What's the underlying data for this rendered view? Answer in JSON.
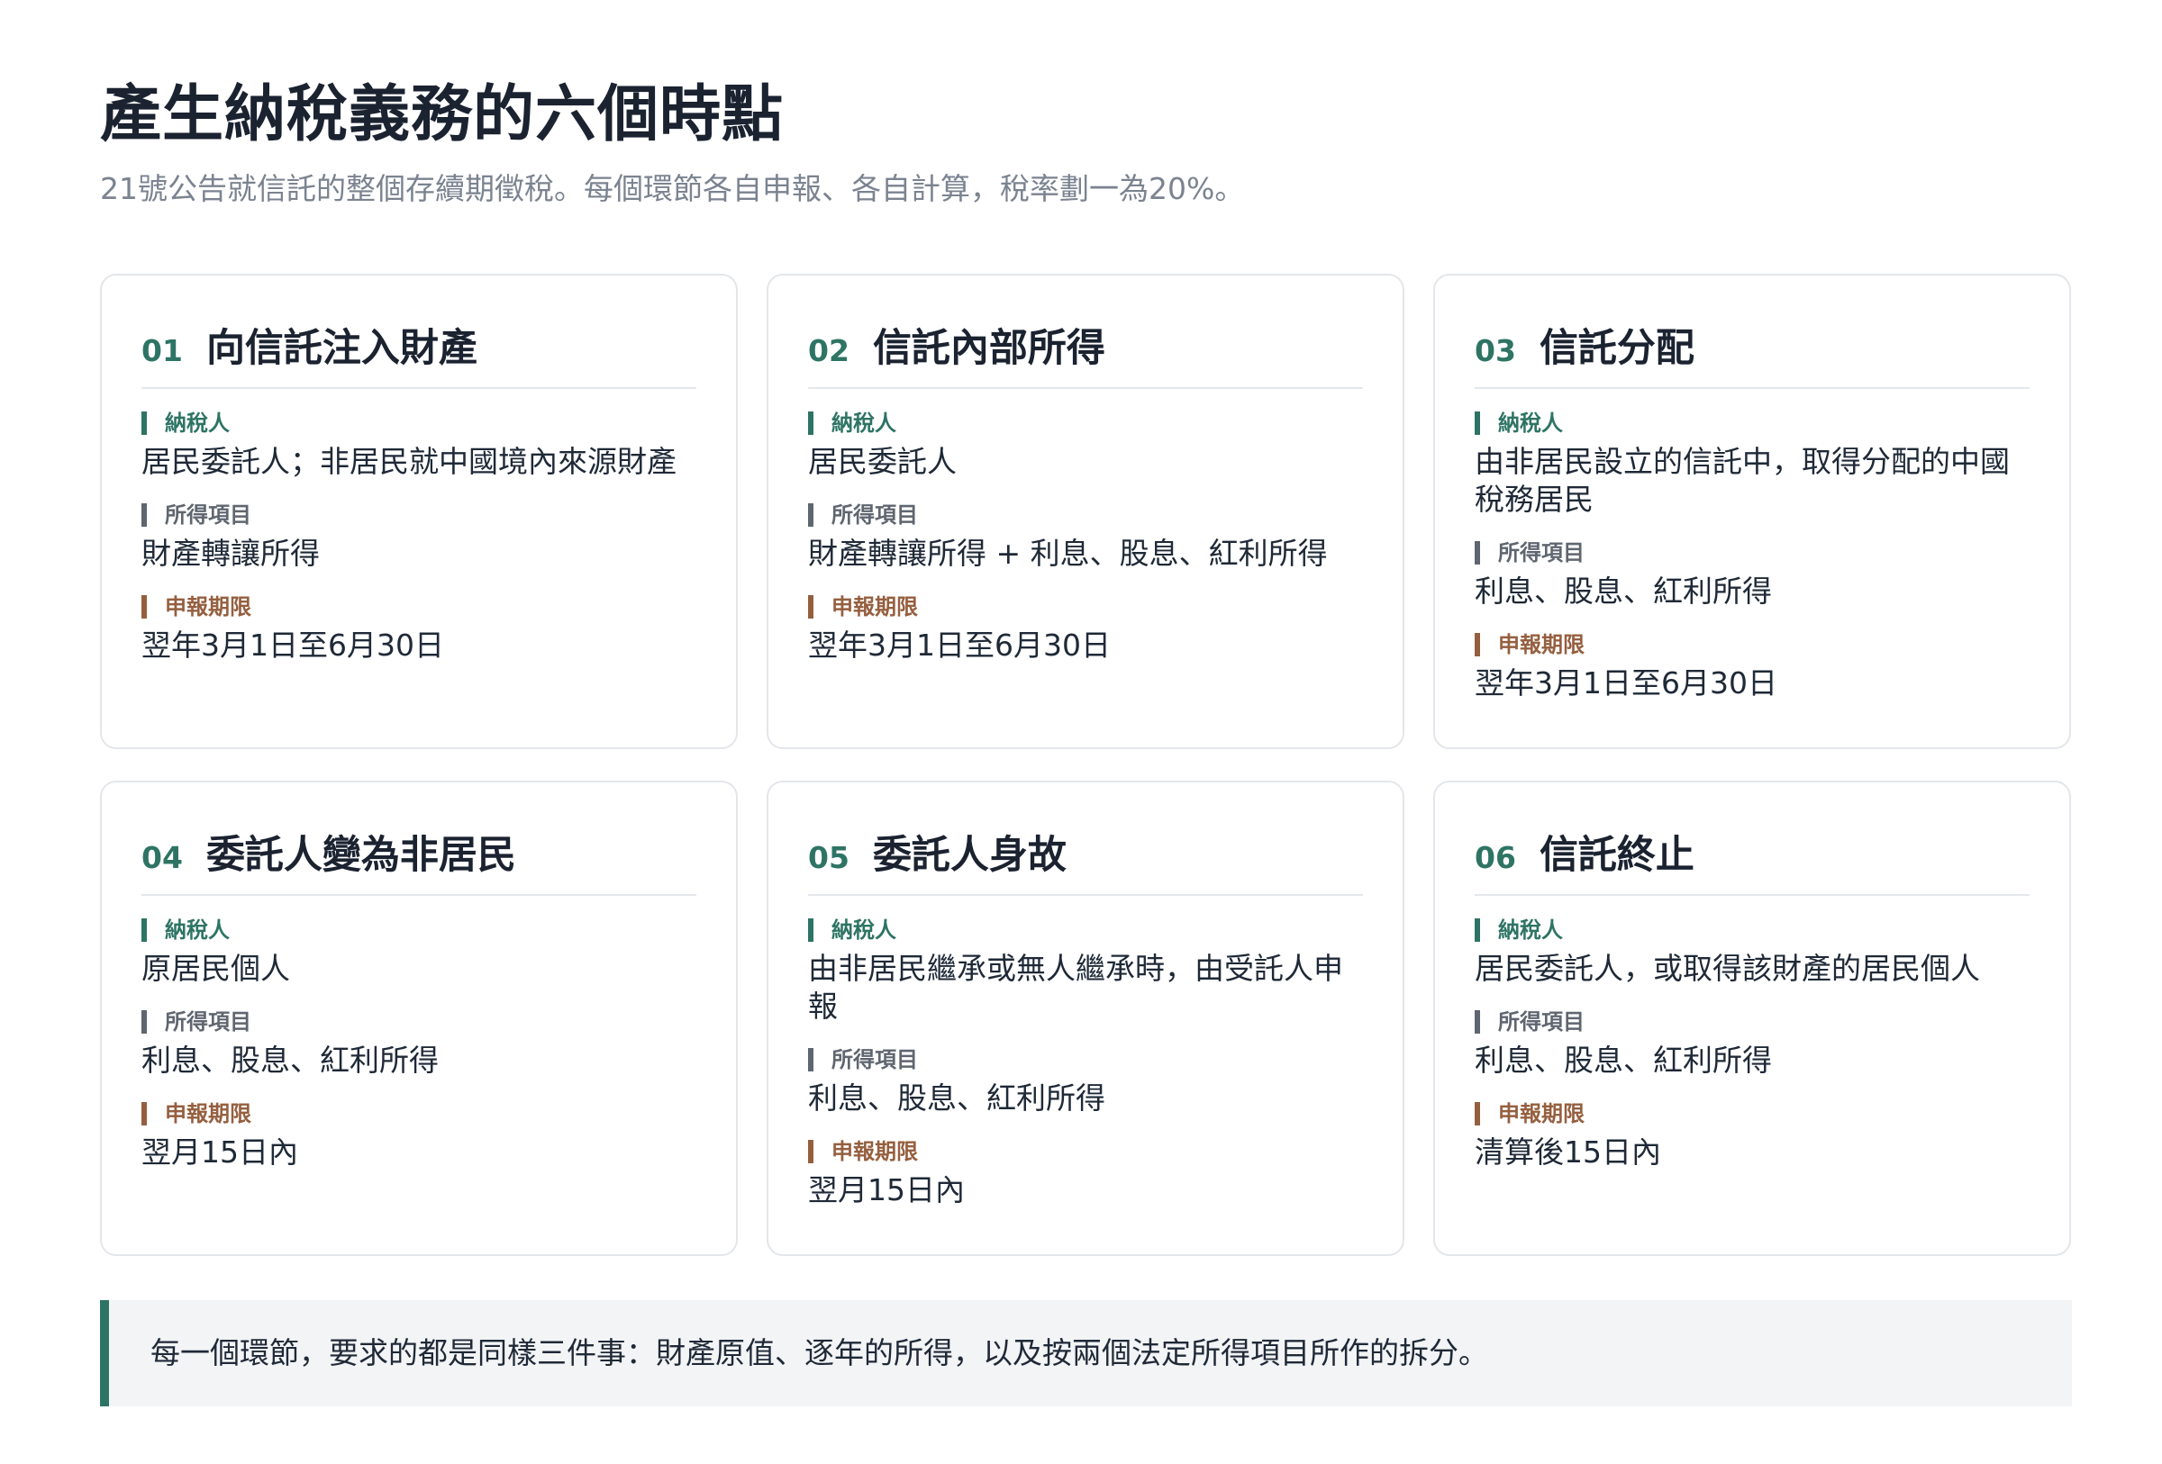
{
  "header": {
    "title": "產生納稅義務的六個時點",
    "subtitle": "21號公告就信託的整個存續期徵稅。每個環節各自申報、各自計算，稅率劃一為20%。"
  },
  "labels": {
    "taxpayer": "納稅人",
    "income_item": "所得項目",
    "deadline": "申報期限"
  },
  "cards": [
    {
      "num": "01",
      "title": "向信託注入財產",
      "taxpayer": "居民委託人；非居民就中國境內來源財產",
      "income_item": "財產轉讓所得",
      "deadline": "翌年3月1日至6月30日"
    },
    {
      "num": "02",
      "title": "信託內部所得",
      "taxpayer": "居民委託人",
      "income_item": "財產轉讓所得 + 利息、股息、紅利所得",
      "deadline": "翌年3月1日至6月30日"
    },
    {
      "num": "03",
      "title": "信託分配",
      "taxpayer": "由非居民設立的信託中，取得分配的中國稅務居民",
      "income_item": "利息、股息、紅利所得",
      "deadline": "翌年3月1日至6月30日"
    },
    {
      "num": "04",
      "title": "委託人變為非居民",
      "taxpayer": "原居民個人",
      "income_item": "利息、股息、紅利所得",
      "deadline": "翌月15日內"
    },
    {
      "num": "05",
      "title": "委託人身故",
      "taxpayer": "由非居民繼承或無人繼承時，由受託人申報",
      "income_item": "利息、股息、紅利所得",
      "deadline": "翌月15日內"
    },
    {
      "num": "06",
      "title": "信託終止",
      "taxpayer": "居民委託人，或取得該財產的居民個人",
      "income_item": "利息、股息、紅利所得",
      "deadline": "清算後15日內"
    }
  ],
  "note": {
    "text": "每一個環節，要求的都是同樣三件事：財產原值、逐年的所得，以及按兩個法定所得項目所作的拆分。"
  },
  "colors": {
    "accent_green": "#2e7465",
    "label_gray": "#5f6670",
    "deadline_brown": "#955f3f"
  }
}
